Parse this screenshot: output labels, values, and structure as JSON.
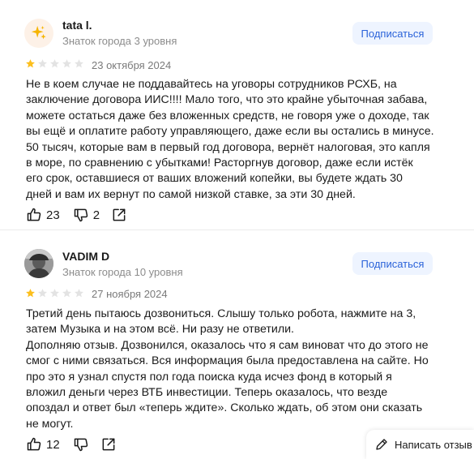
{
  "reviews": [
    {
      "author": "tata l.",
      "level": "Знаток города 3 уровня",
      "subscribe_label": "Подписаться",
      "rating": 1,
      "max_rating": 5,
      "date": "23 октября 2024",
      "text": "Не в коем случае не поддавайтесь на уговоры сотрудников РСХБ, на\nзаключение договора ИИС!!!! Мало того, что это крайне убыточная забава,\nможете остаться даже без вложенных средств, не говоря уже о доходе, так\nвы ещё и оплатите работу управляющего, даже если вы остались в минусе.\n50 тысяч, которые вам в первый год договора, вернёт налоговая, это капля\nв море, по сравнению с убытками! Расторгнув договор, даже если истёк\nего срок, оставшиеся от ваших вложений копейки, вы будете ждать 30\nдней и вам их вернут по самой низкой ставке, за эти 30 дней.",
      "likes": "23",
      "dislikes": "2",
      "avatar_icon": "sparkles-icon"
    },
    {
      "author": "VADIM D",
      "level": "Знаток города 10 уровня",
      "subscribe_label": "Подписаться",
      "rating": 1,
      "max_rating": 5,
      "date": "27 ноября 2024",
      "text": "Третий день пытаюсь дозвониться. Слышу только робота, нажмите на 3,\nзатем Музыка и на этом всё. Ни разу не ответили.\nДополняю отзыв. Дозвонился, оказалось что я сам виноват что до этого не\nсмог с ними связаться. Вся информация была предоставлена на сайте. Но\nпро это я узнал спустя пол года поиска куда исчез фонд в который я\nвложил деньги через ВТБ инвестиции. Теперь оказалось, что везде\nопоздал и ответ был «теперь ждите». Сколько ждать, об этом они сказать\nне могут.",
      "likes": "12",
      "dislikes": "",
      "avatar_icon": "user-photo"
    }
  ],
  "write_review_label": "Написать отзыв",
  "colors": {
    "star_filled": "#fcbf1e",
    "star_empty": "#e3e3e3",
    "subscribe_bg": "#eef4ff",
    "subscribe_text": "#2b63d9"
  }
}
